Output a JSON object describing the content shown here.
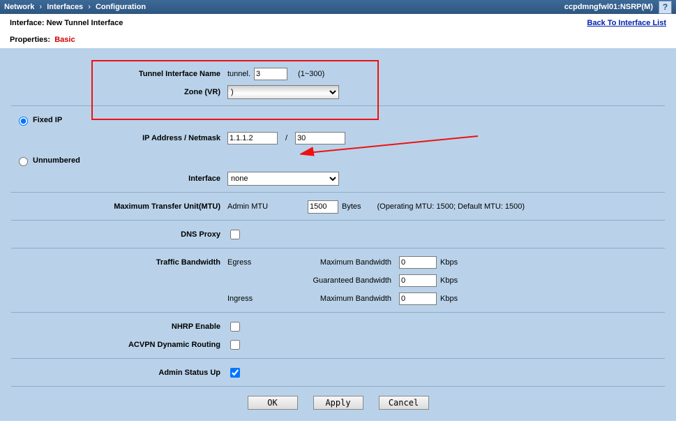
{
  "breadcrumb": {
    "a": "Network",
    "b": "Interfaces",
    "c": "Configuration"
  },
  "systemName": "ccpdmngfwl01:NSRP(M)",
  "help": "?",
  "title": "Interface: New Tunnel Interface",
  "backLink": "Back To Interface List",
  "propsLabel": "Properties:",
  "propsValue": "Basic",
  "labels": {
    "tunnelName": "Tunnel Interface Name",
    "tunnelPrefix": "tunnel.",
    "tunnelRange": "(1~300)",
    "zone": "Zone (VR)",
    "fixedIp": "Fixed IP",
    "ipNetmask": "IP Address / Netmask",
    "slash": "/",
    "unnumbered": "Unnumbered",
    "interface": "Interface",
    "mtu": "Maximum Transfer Unit(MTU)",
    "adminMtu": "Admin MTU",
    "bytes": "Bytes",
    "mtuNote": "(Operating MTU: 1500; Default MTU: 1500)",
    "dnsProxy": "DNS Proxy",
    "trafficBw": "Traffic Bandwidth",
    "egress": "Egress",
    "ingress": "Ingress",
    "maxBw": "Maximum Bandwidth",
    "guaranteedBw": "Guaranteed Bandwidth",
    "kbps": "Kbps",
    "nhrp": "NHRP Enable",
    "acvpn": "ACVPN Dynamic Routing",
    "adminUp": "Admin Status Up"
  },
  "values": {
    "tunnelNum": "3",
    "zone": ")",
    "ip": "1.1.1.2",
    "mask": "30",
    "ifSel": "none",
    "mtu": "1500",
    "egMax": "0",
    "egGuar": "0",
    "inMax": "0",
    "fixedIpChecked": true,
    "unnumberedChecked": false,
    "dnsProxy": false,
    "nhrp": false,
    "acvpn": false,
    "adminUp": true
  },
  "buttons": {
    "ok": "OK",
    "apply": "Apply",
    "cancel": "Cancel"
  }
}
